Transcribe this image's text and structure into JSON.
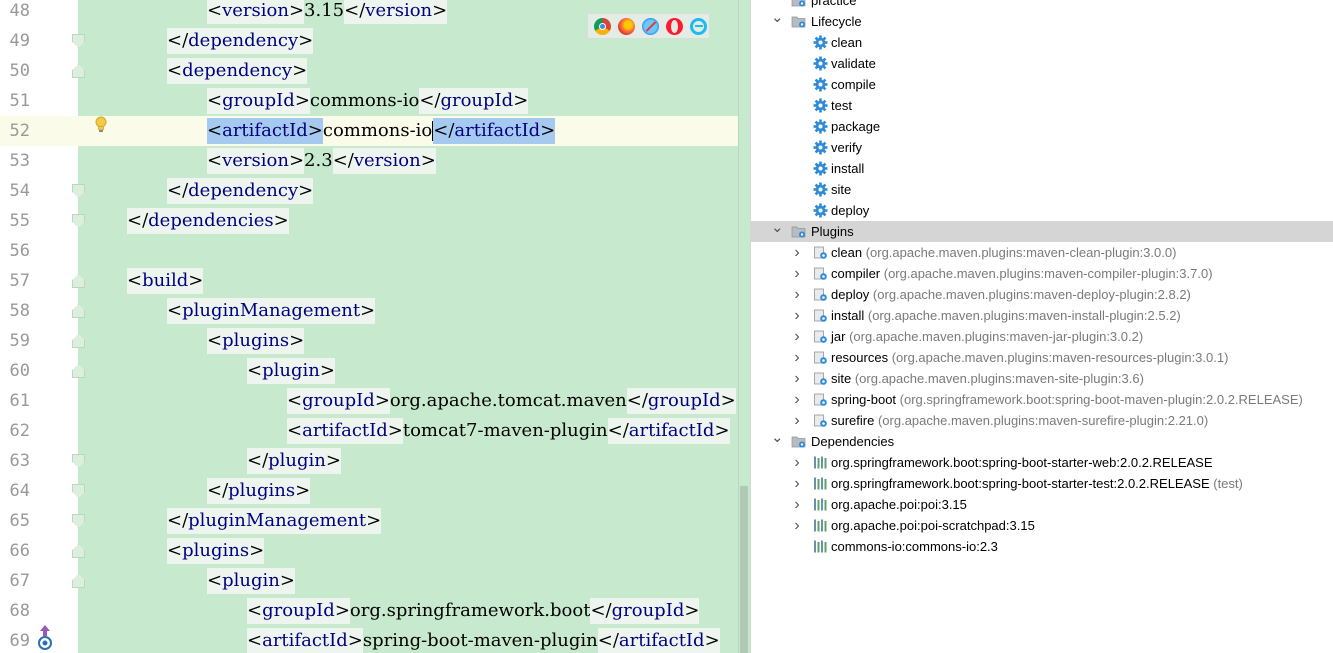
{
  "editor": {
    "lines": [
      {
        "num": "48",
        "indent": 2,
        "parts": [
          [
            "br",
            "<"
          ],
          [
            "tg",
            "version"
          ],
          [
            "br",
            ">"
          ],
          [
            "tx",
            "3.15"
          ],
          [
            "br",
            "</"
          ],
          [
            "tg",
            "version"
          ],
          [
            "br",
            ">"
          ]
        ],
        "fold": ""
      },
      {
        "num": "49",
        "indent": 1,
        "parts": [
          [
            "br",
            "</"
          ],
          [
            "tg",
            "dependency"
          ],
          [
            "br",
            ">"
          ]
        ],
        "fold": "end"
      },
      {
        "num": "50",
        "indent": 1,
        "parts": [
          [
            "br",
            "<"
          ],
          [
            "tg",
            "dependency"
          ],
          [
            "br",
            ">"
          ]
        ],
        "fold": "start"
      },
      {
        "num": "51",
        "indent": 2,
        "parts": [
          [
            "br",
            "<"
          ],
          [
            "tg",
            "groupId"
          ],
          [
            "br",
            ">"
          ],
          [
            "tx",
            "commons-io"
          ],
          [
            "br",
            "</"
          ],
          [
            "tg",
            "groupId"
          ],
          [
            "br",
            ">"
          ]
        ],
        "fold": ""
      },
      {
        "num": "52",
        "indent": 2,
        "parts": [
          [
            "selbr",
            "<"
          ],
          [
            "seltg",
            "artifactId"
          ],
          [
            "selbr",
            ">"
          ],
          [
            "tx",
            "commons-io"
          ],
          [
            "caret",
            ""
          ],
          [
            "selbr",
            "</"
          ],
          [
            "seltg",
            "artifactId"
          ],
          [
            "selbr",
            ">"
          ]
        ],
        "fold": "",
        "current": true
      },
      {
        "num": "53",
        "indent": 2,
        "parts": [
          [
            "br",
            "<"
          ],
          [
            "tg",
            "version"
          ],
          [
            "br",
            ">"
          ],
          [
            "tx",
            "2.3"
          ],
          [
            "br",
            "</"
          ],
          [
            "tg",
            "version"
          ],
          [
            "br",
            ">"
          ]
        ],
        "fold": ""
      },
      {
        "num": "54",
        "indent": 1,
        "parts": [
          [
            "br",
            "</"
          ],
          [
            "tg",
            "dependency"
          ],
          [
            "br",
            ">"
          ]
        ],
        "fold": "end"
      },
      {
        "num": "55",
        "indent": 0,
        "parts": [
          [
            "br",
            "</"
          ],
          [
            "tg",
            "dependencies"
          ],
          [
            "br",
            ">"
          ]
        ],
        "fold": "end"
      },
      {
        "num": "56",
        "indent": 0,
        "parts": [],
        "fold": ""
      },
      {
        "num": "57",
        "indent": 0,
        "parts": [
          [
            "br",
            "<"
          ],
          [
            "tg",
            "build"
          ],
          [
            "br",
            ">"
          ]
        ],
        "fold": "start"
      },
      {
        "num": "58",
        "indent": 1,
        "parts": [
          [
            "br",
            "<"
          ],
          [
            "tg",
            "pluginManagement"
          ],
          [
            "br",
            ">"
          ]
        ],
        "fold": "start"
      },
      {
        "num": "59",
        "indent": 2,
        "parts": [
          [
            "br",
            "<"
          ],
          [
            "tg",
            "plugins"
          ],
          [
            "br",
            ">"
          ]
        ],
        "fold": "start"
      },
      {
        "num": "60",
        "indent": 3,
        "parts": [
          [
            "br",
            "<"
          ],
          [
            "tg",
            "plugin"
          ],
          [
            "br",
            ">"
          ]
        ],
        "fold": "start"
      },
      {
        "num": "61",
        "indent": 4,
        "parts": [
          [
            "br",
            "<"
          ],
          [
            "tg",
            "groupId"
          ],
          [
            "br",
            ">"
          ],
          [
            "tx",
            "org.apache.tomcat.maven"
          ],
          [
            "br",
            "</"
          ],
          [
            "tg",
            "groupId"
          ],
          [
            "br",
            ">"
          ]
        ],
        "fold": ""
      },
      {
        "num": "62",
        "indent": 4,
        "parts": [
          [
            "br",
            "<"
          ],
          [
            "tg",
            "artifactId"
          ],
          [
            "br",
            ">"
          ],
          [
            "tx",
            "tomcat7-maven-plugin"
          ],
          [
            "br",
            "</"
          ],
          [
            "tg",
            "artifactId"
          ],
          [
            "br",
            ">"
          ]
        ],
        "fold": ""
      },
      {
        "num": "63",
        "indent": 3,
        "parts": [
          [
            "br",
            "</"
          ],
          [
            "tg",
            "plugin"
          ],
          [
            "br",
            ">"
          ]
        ],
        "fold": "end"
      },
      {
        "num": "64",
        "indent": 2,
        "parts": [
          [
            "br",
            "</"
          ],
          [
            "tg",
            "plugins"
          ],
          [
            "br",
            ">"
          ]
        ],
        "fold": "end"
      },
      {
        "num": "65",
        "indent": 1,
        "parts": [
          [
            "br",
            "</"
          ],
          [
            "tg",
            "pluginManagement"
          ],
          [
            "br",
            ">"
          ]
        ],
        "fold": "end"
      },
      {
        "num": "66",
        "indent": 1,
        "parts": [
          [
            "br",
            "<"
          ],
          [
            "tg",
            "plugins"
          ],
          [
            "br",
            ">"
          ]
        ],
        "fold": "start"
      },
      {
        "num": "67",
        "indent": 2,
        "parts": [
          [
            "br",
            "<"
          ],
          [
            "tg",
            "plugin"
          ],
          [
            "br",
            ">"
          ]
        ],
        "fold": "start"
      },
      {
        "num": "68",
        "indent": 3,
        "parts": [
          [
            "br",
            "<"
          ],
          [
            "tg",
            "groupId"
          ],
          [
            "br",
            ">"
          ],
          [
            "tx",
            "org.springframework.boot"
          ],
          [
            "br",
            "</"
          ],
          [
            "tg",
            "groupId"
          ],
          [
            "br",
            ">"
          ]
        ],
        "fold": ""
      },
      {
        "num": "69",
        "indent": 3,
        "parts": [
          [
            "br",
            "<"
          ],
          [
            "tg",
            "artifactId"
          ],
          [
            "br",
            ">"
          ],
          [
            "tx",
            "spring-boot-maven-plugin"
          ],
          [
            "br",
            "</"
          ],
          [
            "tg",
            "artifactId"
          ],
          [
            "br",
            ">"
          ]
        ],
        "fold": ""
      }
    ],
    "browsers": [
      "chrome-icon",
      "firefox-icon",
      "safari-icon",
      "opera-icon",
      "ie-icon"
    ]
  },
  "maven": {
    "top_partial": "practice",
    "lifecycle_label": "Lifecycle",
    "lifecycle": [
      "clean",
      "validate",
      "compile",
      "test",
      "package",
      "verify",
      "install",
      "site",
      "deploy"
    ],
    "plugins_label": "Plugins",
    "plugins": [
      {
        "name": "clean",
        "detail": "(org.apache.maven.plugins:maven-clean-plugin:3.0.0)"
      },
      {
        "name": "compiler",
        "detail": "(org.apache.maven.plugins:maven-compiler-plugin:3.7.0)"
      },
      {
        "name": "deploy",
        "detail": "(org.apache.maven.plugins:maven-deploy-plugin:2.8.2)"
      },
      {
        "name": "install",
        "detail": "(org.apache.maven.plugins:maven-install-plugin:2.5.2)"
      },
      {
        "name": "jar",
        "detail": "(org.apache.maven.plugins:maven-jar-plugin:3.0.2)"
      },
      {
        "name": "resources",
        "detail": "(org.apache.maven.plugins:maven-resources-plugin:3.0.1)"
      },
      {
        "name": "site",
        "detail": "(org.apache.maven.plugins:maven-site-plugin:3.6)"
      },
      {
        "name": "spring-boot",
        "detail": "(org.springframework.boot:spring-boot-maven-plugin:2.0.2.RELEASE)"
      },
      {
        "name": "surefire",
        "detail": "(org.apache.maven.plugins:maven-surefire-plugin:2.21.0)"
      }
    ],
    "dependencies_label": "Dependencies",
    "dependencies": [
      {
        "name": "org.springframework.boot:spring-boot-starter-web:2.0.2.RELEASE",
        "detail": "",
        "expandable": true
      },
      {
        "name": "org.springframework.boot:spring-boot-starter-test:2.0.2.RELEASE",
        "detail": "(test)",
        "expandable": true
      },
      {
        "name": "org.apache.poi:poi:3.15",
        "detail": "",
        "expandable": true
      },
      {
        "name": "org.apache.poi:poi-scratchpad:3.15",
        "detail": "",
        "expandable": true
      },
      {
        "name": "commons-io:commons-io:2.3",
        "detail": "",
        "expandable": false
      }
    ],
    "colors": {
      "gear": "#2e8bd8",
      "detail": "#7a7a7a",
      "selected_row": "#d5d5d5"
    }
  }
}
